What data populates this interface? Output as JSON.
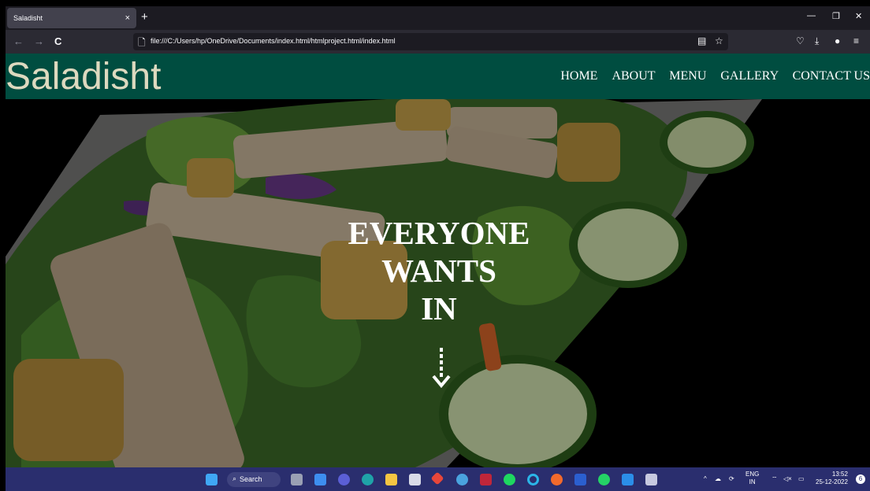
{
  "browser": {
    "tab_title": "Saladisht",
    "tab_close": "×",
    "new_tab": "+",
    "url": "file:///C:/Users/hp/OneDrive/Documents/index.html/htmlproject.html/index.html",
    "back": "←",
    "forward": "→",
    "reload": "C"
  },
  "site": {
    "logo": "Saladisht",
    "nav": [
      "HOME",
      "ABOUT",
      "MENU",
      "GALLERY",
      "CONTACT US"
    ],
    "hero_line1": "EVERYONE",
    "hero_line2": "WANTS",
    "hero_line3": "IN",
    "colors": {
      "header_bg": "#004d40",
      "logo": "#ddd9bf",
      "text": "#ffffff"
    }
  },
  "taskbar": {
    "search_label": "Search",
    "lang_top": "ENG",
    "lang_bottom": "IN",
    "time": "13:52",
    "date": "25-12-2022",
    "notification_count": "6"
  }
}
